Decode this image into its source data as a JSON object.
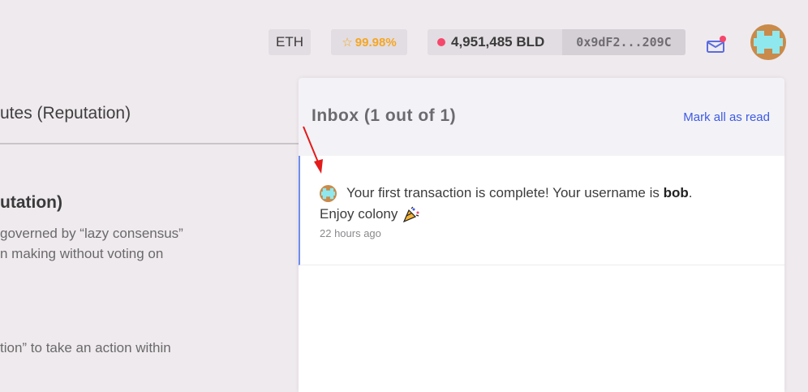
{
  "topbar": {
    "network": "ETH",
    "reputation": "99.98%",
    "balance": "4,951,485 BLD",
    "address": "0x9dF2...209C"
  },
  "left_page": {
    "tab_label": "utes (Reputation)",
    "section_title": "utation)",
    "text_line1": "governed by “lazy consensus”",
    "text_line2": "n making without voting on",
    "text_line3": "tion” to take an action within"
  },
  "inbox": {
    "title": "Inbox (1 out of 1)",
    "mark_all_label": "Mark all as read",
    "notification": {
      "text_before": "Your first transaction is complete! Your username is ",
      "username": "bob",
      "text_after": ".",
      "line2": "Enjoy colony",
      "time": "22 hours ago"
    }
  },
  "colors": {
    "accent_blue": "#3d5ae4",
    "reputation_orange": "#f5a623",
    "token_dot": "#f5476b"
  }
}
